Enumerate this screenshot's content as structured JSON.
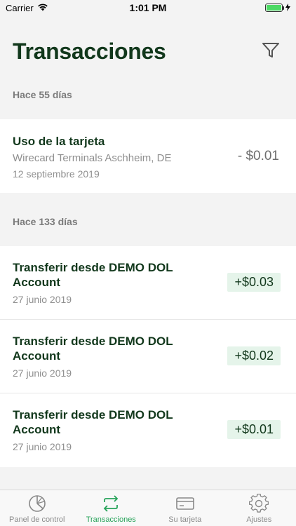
{
  "status": {
    "carrier": "Carrier",
    "time": "1:01 PM"
  },
  "header": {
    "title": "Transacciones"
  },
  "sections": [
    {
      "label": "Hace 55 días",
      "items": [
        {
          "title": "Uso de la tarjeta",
          "merchant": "Wirecard Terminals Aschheim, DE",
          "date": "12 septiembre 2019",
          "amount": "- $0.01"
        }
      ]
    },
    {
      "label": "Hace 133 días",
      "items": [
        {
          "title_line1": "Transferir desde DEMO DOL",
          "title_line2": "Account",
          "date": "27 junio 2019",
          "amount": "+$0.03"
        },
        {
          "title_line1": "Transferir desde DEMO DOL",
          "title_line2": "Account",
          "date": "27 junio 2019",
          "amount": "+$0.02"
        },
        {
          "title_line1": "Transferir desde DEMO DOL",
          "title_line2": "Account",
          "date": "27 junio 2019",
          "amount": "+$0.01"
        }
      ]
    }
  ],
  "tabs": [
    {
      "label": "Panel de control",
      "icon": "pie-chart-icon"
    },
    {
      "label": "Transacciones",
      "icon": "transfer-arrows-icon",
      "active": true
    },
    {
      "label": "Su tarjeta",
      "icon": "card-icon"
    },
    {
      "label": "Ajustes",
      "icon": "gear-icon"
    }
  ],
  "colors": {
    "accent": "#27a35a",
    "title": "#12381c",
    "badge": "#e5f4ea"
  }
}
